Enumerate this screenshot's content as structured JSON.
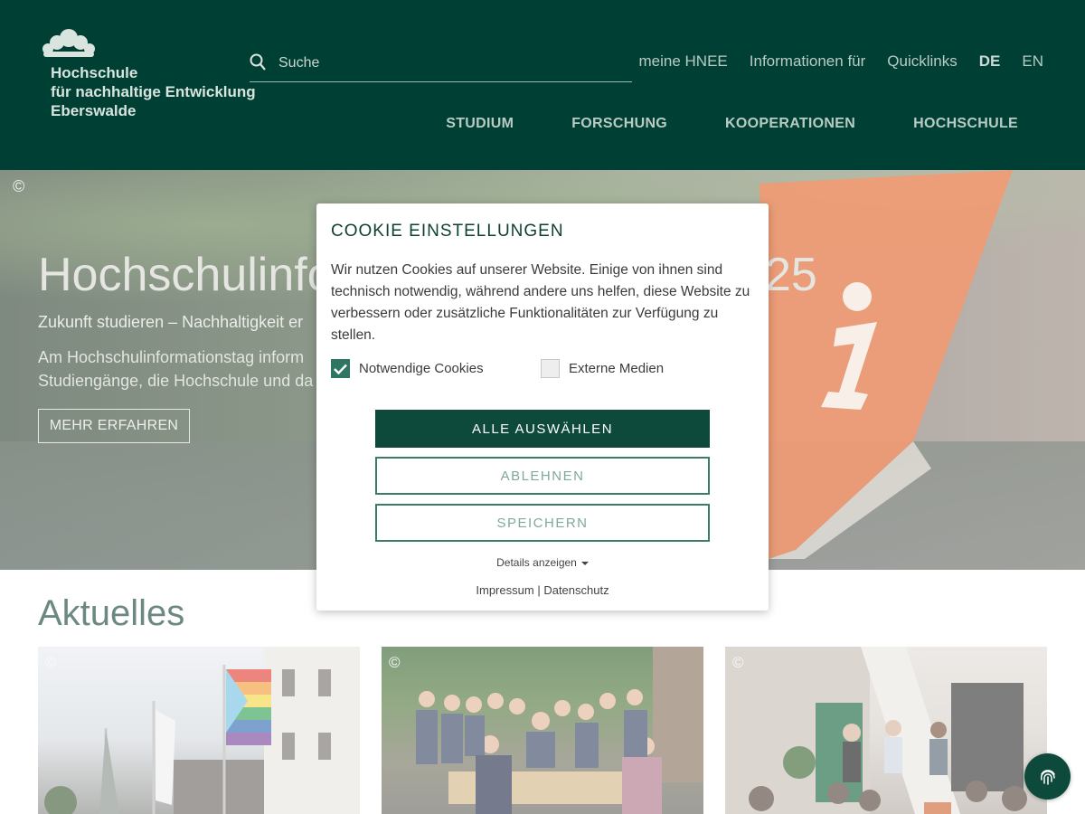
{
  "header": {
    "logo_lines": [
      "Hochschule",
      "für nachhaltige Entwicklung",
      "Eberswalde"
    ],
    "search_placeholder": "Suche",
    "top_nav": [
      "meine HNEE",
      "Informationen für",
      "Quicklinks",
      "DE",
      "EN"
    ],
    "main_nav": [
      "STUDIUM",
      "FORSCHUNG",
      "KOOPERATIONEN",
      "HOCHSCHULE"
    ]
  },
  "hero": {
    "copyright": "©",
    "title_start": "Hochschulinfo",
    "title_end": "25",
    "subtitle": "Zukunft studieren – Nachhaltigkeit er",
    "body_lines": [
      "Am Hochschulinformationstag inform",
      "Studiengänge, die Hochschule und da"
    ],
    "button": "MEHR ERFAHREN"
  },
  "news": {
    "heading": "Aktuelles",
    "card_copyright": "©"
  },
  "cookie": {
    "title": "COOKIE EINSTELLUNGEN",
    "text": "Wir nutzen Cookies auf unserer Website. Einige von ihnen sind technisch notwendig, während andere uns helfen, diese Website zu verbessern oder zusätzliche Funktionalitäten zur Verfügung zu stellen.",
    "necessary_label": "Notwendige Cookies",
    "external_label": "Externe Medien",
    "select_all": "ALLE AUSWÄHLEN",
    "decline": "ABLEHNEN",
    "save": "SPEICHERN",
    "details": "Details anzeigen",
    "imprint": "Impressum",
    "separator": "|",
    "privacy": "Datenschutz"
  },
  "colors": {
    "header_bg": "#003f33",
    "primary_button": "#0e4a3b",
    "flag": "#e8662a"
  }
}
